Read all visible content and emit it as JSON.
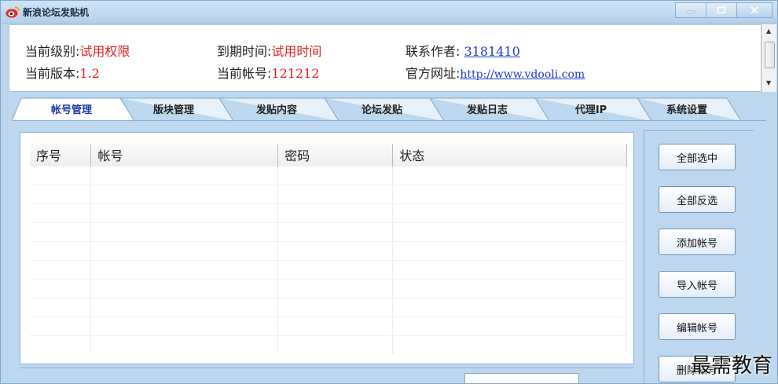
{
  "window": {
    "title": "新浪论坛发贴机",
    "icon": "weibo-logo-icon",
    "controls": [
      "minimize-icon",
      "maximize-icon",
      "close-icon"
    ]
  },
  "info": {
    "level_label": "当前级别:",
    "level_value": "试用权限",
    "version_label": "当前版本:",
    "version_value": "1.2",
    "expire_label": "到期时间:",
    "expire_value": "试用时间",
    "account_label": "当前帐号:",
    "account_value": "121212",
    "author_label": "联系作者: ",
    "author_value": "3181410",
    "site_label": "官方网址:",
    "site_value": "http://www.vdooli.com"
  },
  "tabs": [
    {
      "label": "帐号管理",
      "active": true
    },
    {
      "label": "版块管理",
      "active": false
    },
    {
      "label": "发贴内容",
      "active": false
    },
    {
      "label": "论坛发贴",
      "active": false
    },
    {
      "label": "发贴日志",
      "active": false
    },
    {
      "label": "代理IP",
      "active": false
    },
    {
      "label": "系统设置",
      "active": false
    }
  ],
  "accounts_table": {
    "columns": [
      "序号",
      "帐号",
      "密码",
      "状态"
    ],
    "rows": []
  },
  "buttons": {
    "select_all": "全部选中",
    "invert_selection": "全部反选",
    "add_account": "添加帐号",
    "import_account": "导入帐号",
    "edit_account": "编辑帐号",
    "delete_account": "删除帐号"
  },
  "watermark": "最需教育",
  "colors": {
    "accent_red": "#e02020",
    "link_blue": "#1a3dd0",
    "window_bg": "#bcd7ee"
  }
}
